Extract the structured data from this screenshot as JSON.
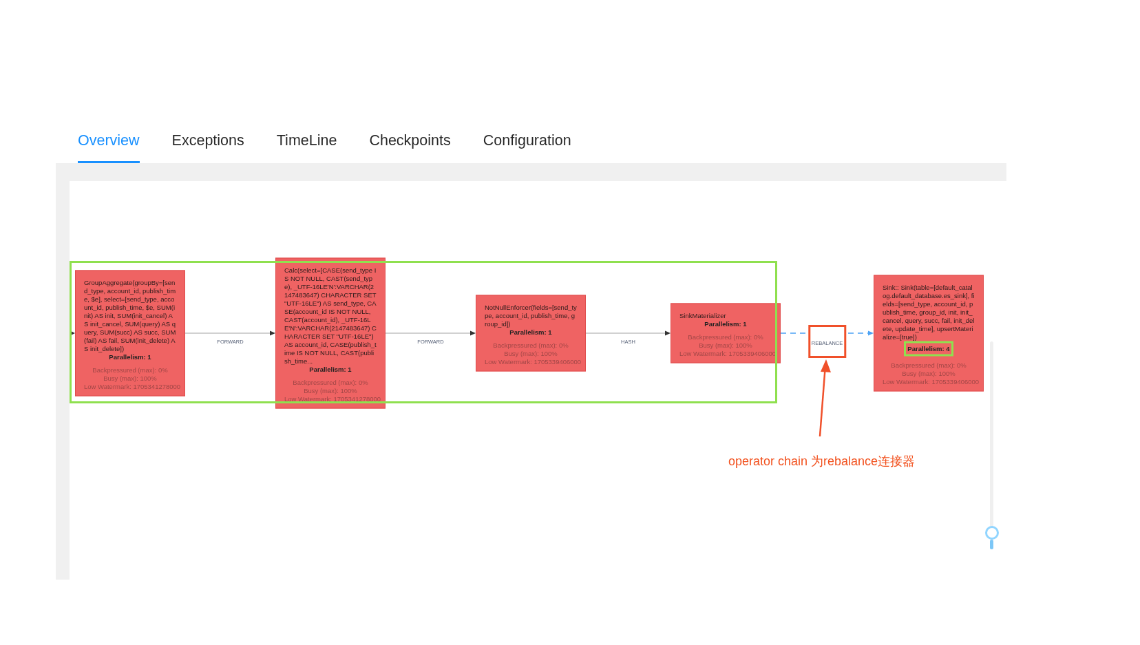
{
  "tabs": [
    {
      "label": "Overview",
      "selected": true
    },
    {
      "label": "Exceptions",
      "selected": false
    },
    {
      "label": "TimeLine",
      "selected": false
    },
    {
      "label": "Checkpoints",
      "selected": false
    },
    {
      "label": "Configuration",
      "selected": false
    }
  ],
  "job_graph": {
    "nodes": [
      {
        "description": "GroupAggregate(groupBy=[send_type, account_id, publish_time, $e], select=[send_type, account_id, publish_time, $e, SUM(init) AS init, SUM(init_cancel) AS init_cancel, SUM(query) AS query, SUM(succ) AS succ, SUM(fail) AS fail, SUM(init_delete) AS init_delete])",
        "parallelism": "Parallelism: 1",
        "metrics": [
          "Backpressured (max): 0%",
          "Busy (max): 100%",
          "Low Watermark: 1705341278000"
        ],
        "highlighted": false
      },
      {
        "description": "Calc(select=[CASE(send_type IS NOT NULL, CAST(send_type), _UTF-16LE'N':VARCHAR(2147483647) CHARACTER SET \"UTF-16LE\") AS send_type, CASE(account_id IS NOT NULL, CAST(account_id), _UTF-16LE'N':VARCHAR(2147483647) CHARACTER SET \"UTF-16LE\") AS account_id, CASE(publish_time IS NOT NULL, CAST(publish_time...",
        "parallelism": "Parallelism: 1",
        "metrics": [
          "Backpressured (max): 0%",
          "Busy (max): 100%",
          "Low Watermark: 1705341278000"
        ],
        "highlighted": false
      },
      {
        "description": "NotNullEnforcer(fields=[send_type, account_id, publish_time, group_id])",
        "parallelism": "Parallelism: 1",
        "metrics": [
          "Backpressured (max): 0%",
          "Busy (max): 100%",
          "Low Watermark: 1705339406000"
        ],
        "highlighted": false
      },
      {
        "description": "SinkMaterializer",
        "parallelism": "Parallelism: 1",
        "metrics": [
          "Backpressured (max): 0%",
          "Busy (max): 100%",
          "Low Watermark: 1705339406000"
        ],
        "highlighted": false
      },
      {
        "description": "Sink:: Sink(table=[default_catalog.default_database.es_sink], fields=[send_type, account_id, publish_time, group_id, init, init_cancel, query, succ, fail, init_delete, update_time], upsertMaterialize=[true])",
        "parallelism": "Parallelism: 4",
        "metrics": [
          "Backpressured (max): 0%",
          "Busy (max): 100%",
          "Low Watermark: 1705339406000"
        ],
        "highlighted": true
      }
    ],
    "edges": [
      {
        "label": "FORWARD",
        "kind": "solid",
        "highlighted": false
      },
      {
        "label": "FORWARD",
        "kind": "solid",
        "highlighted": false
      },
      {
        "label": "HASH",
        "kind": "solid",
        "highlighted": false
      },
      {
        "label": "REBALANCE",
        "kind": "dashed",
        "highlighted": true
      }
    ]
  },
  "annotation": {
    "note": "operator chain 为rebalance连接器"
  },
  "zoom_slider": {
    "level": 0.08
  }
}
